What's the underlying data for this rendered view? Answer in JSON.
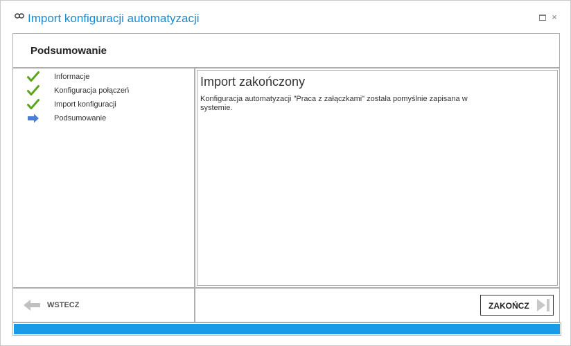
{
  "window": {
    "title": "Import konfiguracji automatyzacji",
    "maximize_icon": "maximize-icon",
    "close_icon": "close-icon",
    "close_glyph": "×"
  },
  "header": {
    "title": "Podsumowanie"
  },
  "steps": [
    {
      "label": "Informacje",
      "status": "done",
      "icon": "check-icon"
    },
    {
      "label": "Konfiguracja połączeń",
      "status": "done",
      "icon": "check-icon"
    },
    {
      "label": "Import konfiguracji",
      "status": "done",
      "icon": "check-icon"
    },
    {
      "label": "Podsumowanie",
      "status": "current",
      "icon": "arrow-right-icon"
    }
  ],
  "content": {
    "title": "Import zakończony",
    "text": "Konfiguracja automatyzacji \"Praca z załączkami\" została pomyślnie zapisana w systemie."
  },
  "footer": {
    "back_label": "WSTECZ",
    "back_enabled": false,
    "finish_label": "ZAKOŃCZ"
  },
  "progress": {
    "fraction": 1.0
  },
  "colors": {
    "accent": "#1a8ad0",
    "progress": "#1a9be8",
    "check": "#5aa51c",
    "arrow": "#4a7fd6",
    "disabled": "#c0c0c0"
  }
}
